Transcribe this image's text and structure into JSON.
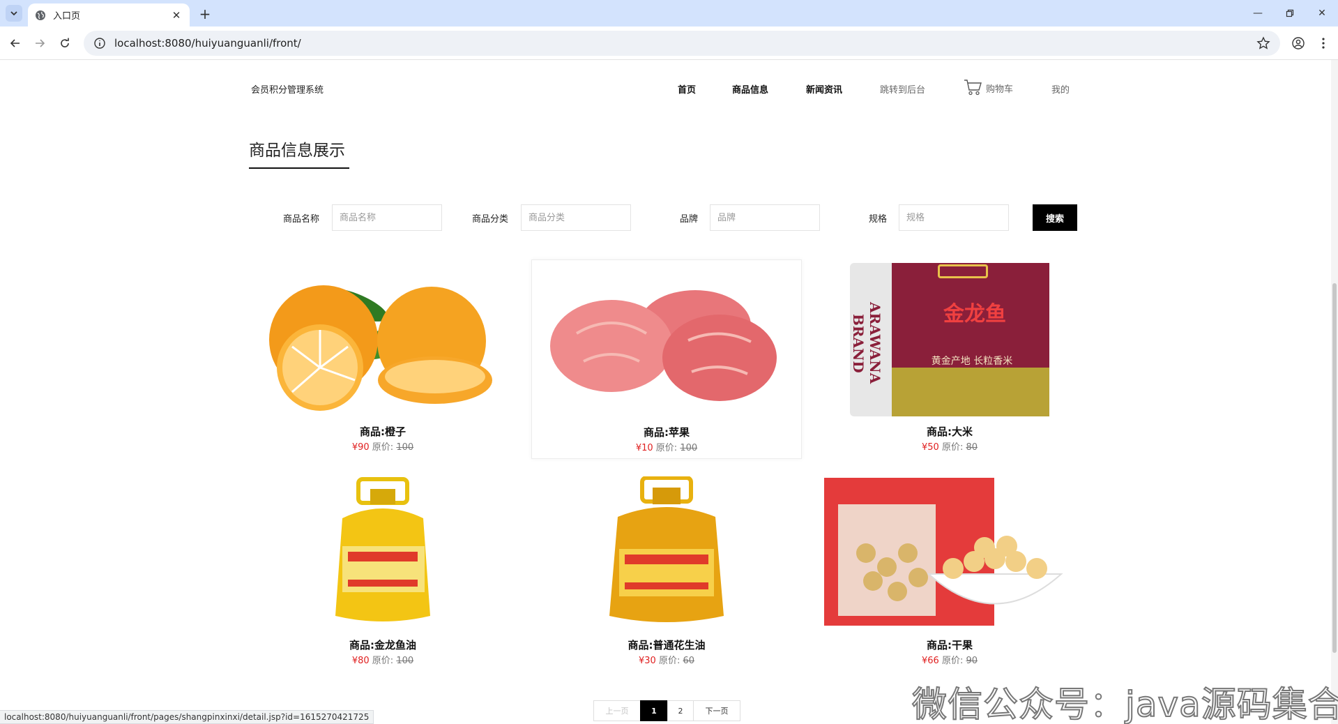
{
  "browser": {
    "tab_title": "入口页",
    "url": "localhost:8080/huiyuanguanli/front/",
    "status_url": "localhost:8080/huiyuanguanli/front/pages/shangpinxinxi/detail.jsp?id=1615270421725"
  },
  "header": {
    "brand": "会员积分管理系统",
    "menu": [
      "首页",
      "商品信息",
      "新闻资讯",
      "跳转到后台"
    ],
    "cart_label": "购物车",
    "mine_label": "我的"
  },
  "section_title": "商品信息展示",
  "search": {
    "name_label": "商品名称",
    "name_placeholder": "商品名称",
    "category_label": "商品分类",
    "category_placeholder": "商品分类",
    "brand_label": "品牌",
    "brand_placeholder": "品牌",
    "spec_label": "规格",
    "spec_placeholder": "规格",
    "button": "搜索"
  },
  "products": [
    {
      "name": "商品:橙子",
      "price": "¥90",
      "orig_label": "原价:",
      "orig": "100",
      "image": "orange-image"
    },
    {
      "name": "商品:苹果",
      "price": "¥10",
      "orig_label": "原价:",
      "orig": "100",
      "image": "apple-image"
    },
    {
      "name": "商品:大米",
      "price": "¥50",
      "orig_label": "原价:",
      "orig": "80",
      "image": "rice-bag-image",
      "bag_text": "金龙鱼",
      "bag_side": "ARAWANA BRAND",
      "bag_sub": "黄金产地 长粒香米"
    },
    {
      "name": "商品:金龙鱼油",
      "price": "¥80",
      "orig_label": "原价:",
      "orig": "100",
      "image": "oil-bottle-image"
    },
    {
      "name": "商品:普通花生油",
      "price": "¥30",
      "orig_label": "原价:",
      "orig": "60",
      "image": "oil-bottle-image"
    },
    {
      "name": "商品:干果",
      "price": "¥66",
      "orig_label": "原价:",
      "orig": "90",
      "image": "nuts-image"
    }
  ],
  "pagination": {
    "prev": "上一页",
    "pages": [
      "1",
      "2"
    ],
    "current": "1",
    "next": "下一页"
  },
  "watermark": "微信公众号：java源码集合",
  "colors": {
    "accent": "#000000",
    "price": "#e02020",
    "tabbar": "#d3e3fd"
  }
}
